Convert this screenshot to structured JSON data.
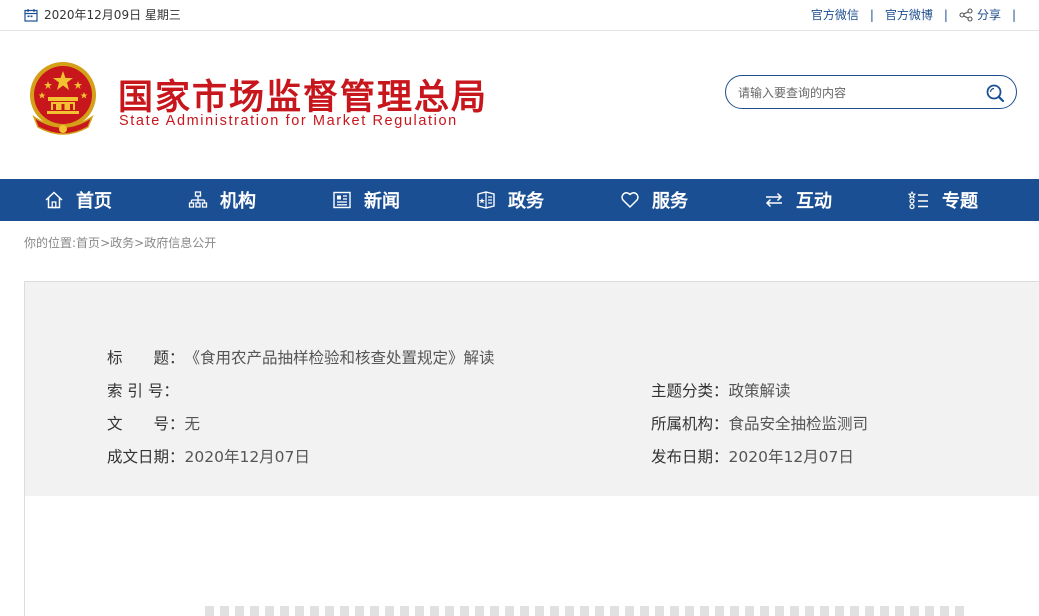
{
  "topbar": {
    "date": "2020年12月09日 星期三",
    "links": [
      "官方微信",
      "官方微博",
      "分享"
    ],
    "separator": "|"
  },
  "header": {
    "title": "国家市场监督管理总局",
    "subtitle": "State Administration for Market Regulation",
    "search_placeholder": "请输入要查询的内容"
  },
  "nav": {
    "items": [
      {
        "label": "首页",
        "icon": "home-icon"
      },
      {
        "label": "机构",
        "icon": "org-chart-icon"
      },
      {
        "label": "新闻",
        "icon": "newspaper-icon"
      },
      {
        "label": "政务",
        "icon": "shield-book-icon"
      },
      {
        "label": "服务",
        "icon": "heart-icon"
      },
      {
        "label": "互动",
        "icon": "exchange-arrows-icon"
      },
      {
        "label": "专题",
        "icon": "list-icon"
      }
    ]
  },
  "breadcrumb": {
    "prefix": "你的位置:",
    "items": [
      "首页",
      "政务",
      "政府信息公开"
    ],
    "sep": ">"
  },
  "info": {
    "title_label": "标　　题：",
    "title_value": "《食用农产品抽样检验和核查处置规定》解读",
    "index_label": "索 引 号：",
    "index_value": "",
    "topic_label": "主题分类：",
    "topic_value": "政策解读",
    "doc_label": "文　　号：",
    "doc_value": "无",
    "org_label": "所属机构：",
    "org_value": "食品安全抽检监测司",
    "created_label": "成文日期：",
    "created_value": "2020年12月07日",
    "published_label": "发布日期：",
    "published_value": "2020年12月07日"
  },
  "colors": {
    "brand_red": "#c8161d",
    "nav_blue": "#1b4f93",
    "info_bg": "#f2f2f2"
  }
}
